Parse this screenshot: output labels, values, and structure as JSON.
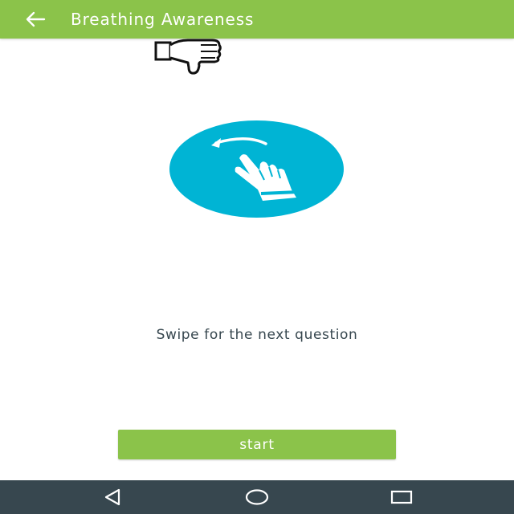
{
  "app_bar": {
    "title": "Breathing Awareness",
    "back_icon": "arrow-left-icon",
    "color": "#8bc34a"
  },
  "feedback": {
    "icon": "thumbs-down-icon"
  },
  "illustration": {
    "icon": "swipe-gesture-icon",
    "circle_color": "#00b4d4"
  },
  "hint": {
    "text": "Swipe for the next question"
  },
  "start_button": {
    "label": "start",
    "color": "#8bc34a"
  },
  "nav_bar": {
    "color": "#37474f",
    "icons": [
      "nav-back-icon",
      "nav-home-icon",
      "nav-recents-icon"
    ]
  }
}
